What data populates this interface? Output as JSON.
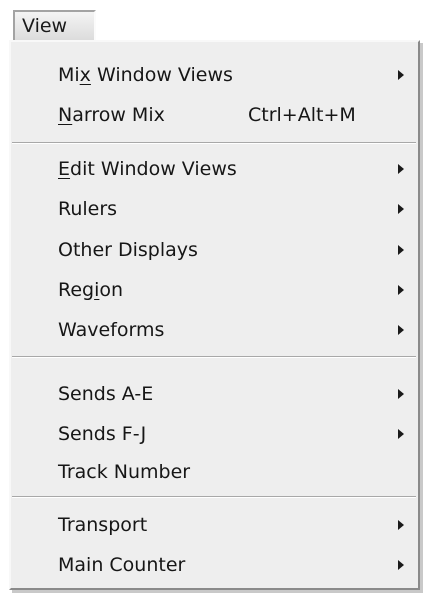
{
  "menubar": {
    "view_label": "View"
  },
  "menu": {
    "items": [
      {
        "pre": "Mi",
        "mn": "x",
        "post": " Window Views",
        "shortcut": "",
        "submenu": true
      },
      {
        "pre": "",
        "mn": "N",
        "post": "arrow Mix",
        "shortcut": "Ctrl+Alt+M",
        "submenu": false
      },
      {
        "pre": "",
        "mn": "E",
        "post": "dit Window Views",
        "shortcut": "",
        "submenu": true
      },
      {
        "pre": "Rulers",
        "mn": "",
        "post": "",
        "shortcut": "",
        "submenu": true
      },
      {
        "pre": "Other Displays",
        "mn": "",
        "post": "",
        "shortcut": "",
        "submenu": true
      },
      {
        "pre": "Reg",
        "mn": "i",
        "post": "on",
        "shortcut": "",
        "submenu": true
      },
      {
        "pre": "Waveforms",
        "mn": "",
        "post": "",
        "shortcut": "",
        "submenu": true
      },
      {
        "pre": "Sends A-E",
        "mn": "",
        "post": "",
        "shortcut": "",
        "submenu": true
      },
      {
        "pre": "Sends F-J",
        "mn": "",
        "post": "",
        "shortcut": "",
        "submenu": true
      },
      {
        "pre": "Track Number",
        "mn": "",
        "post": "",
        "shortcut": "",
        "submenu": false
      },
      {
        "pre": "Transport",
        "mn": "",
        "post": "",
        "shortcut": "",
        "submenu": true
      },
      {
        "pre": "Main Counter",
        "mn": "",
        "post": "",
        "shortcut": "",
        "submenu": true
      }
    ]
  }
}
